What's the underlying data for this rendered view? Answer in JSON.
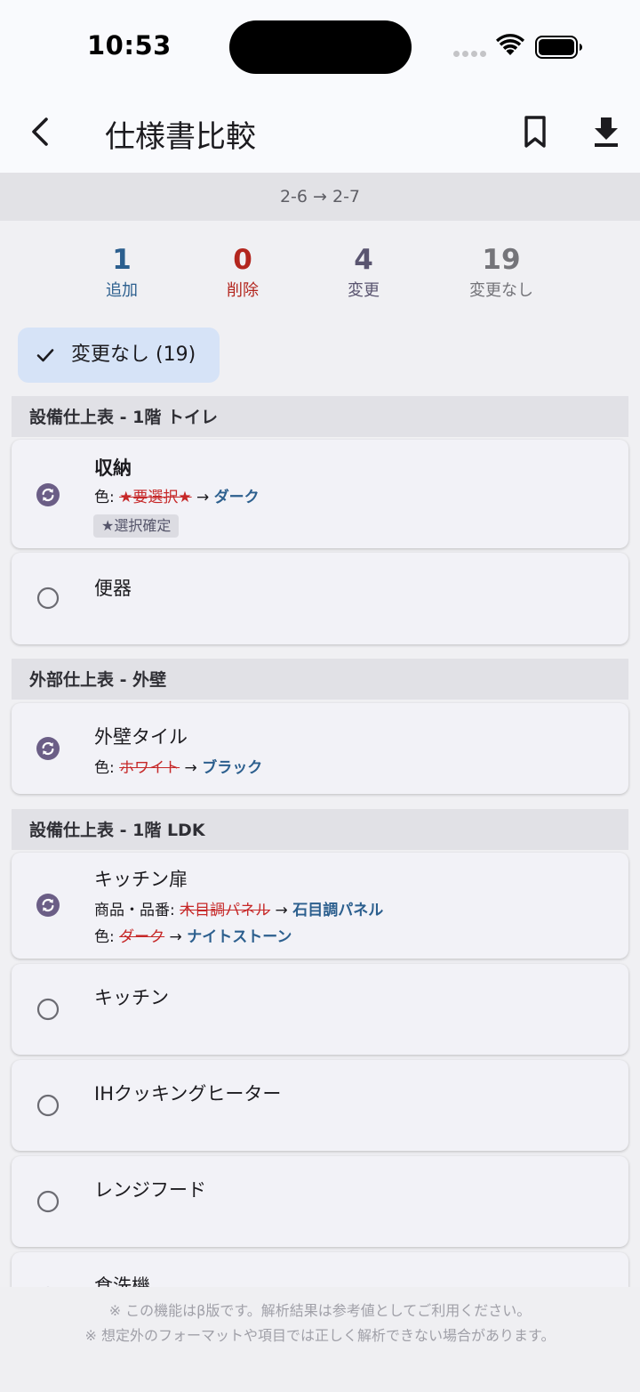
{
  "status_bar": {
    "time": "10:53"
  },
  "header": {
    "title": "仕様書比較"
  },
  "version": {
    "label": "2-6 → 2-7"
  },
  "stats": [
    {
      "value": "1",
      "label": "追加",
      "color": "#2c5f8e"
    },
    {
      "value": "0",
      "label": "削除",
      "color": "#b3261e"
    },
    {
      "value": "4",
      "label": "変更",
      "color": "#5a5570"
    },
    {
      "value": "19",
      "label": "変更なし",
      "color": "#747479"
    }
  ],
  "filter": {
    "label": "変更なし (19)"
  },
  "sections": [
    {
      "title": "設備仕上表 - 1階 トイレ",
      "items": [
        {
          "name": "収納",
          "status": "changed",
          "changes": [
            {
              "field": "色: ",
              "old": "★要選択★",
              "arrow": " → ",
              "new": "ダーク"
            }
          ],
          "tag": "★選択確定"
        },
        {
          "name": "便器",
          "status": "unchanged"
        }
      ]
    },
    {
      "title": "外部仕上表 - 外壁",
      "items": [
        {
          "name": "外壁タイル",
          "status": "changed",
          "changes": [
            {
              "field": "色: ",
              "old": "ホワイト",
              "arrow": " → ",
              "new": "ブラック"
            }
          ]
        }
      ]
    },
    {
      "title": "設備仕上表 - 1階 LDK",
      "items": [
        {
          "name": "キッチン扉",
          "status": "changed",
          "changes": [
            {
              "field": "商品・品番: ",
              "old": "木目調パネル",
              "arrow": " → ",
              "new": "石目調パネル"
            },
            {
              "field": "色: ",
              "old": "ダーク",
              "arrow": " → ",
              "new": "ナイトストーン"
            }
          ]
        },
        {
          "name": "キッチン",
          "status": "unchanged"
        },
        {
          "name": "IHクッキングヒーター",
          "status": "unchanged"
        },
        {
          "name": "レンジフード",
          "status": "unchanged"
        },
        {
          "name": "食洗機",
          "status": "unchanged"
        }
      ]
    }
  ],
  "footer": {
    "line1": "※ この機能はβ版です。解析結果は参考値としてご利用ください。",
    "line2": "※ 想定外のフォーマットや項目では正しく解析できない場合があります。"
  },
  "icons": {
    "back": "arrow-back-icon",
    "bookmark": "bookmark-icon",
    "download": "download-icon",
    "check": "check-icon",
    "changed": "sync-icon",
    "unchanged": "radio-empty-icon"
  },
  "colors": {
    "accent_blue": "#2c5f8e",
    "delete_red": "#c62828",
    "changed_icon": "#6b5e86",
    "chip_bg": "#d6e3f7"
  }
}
